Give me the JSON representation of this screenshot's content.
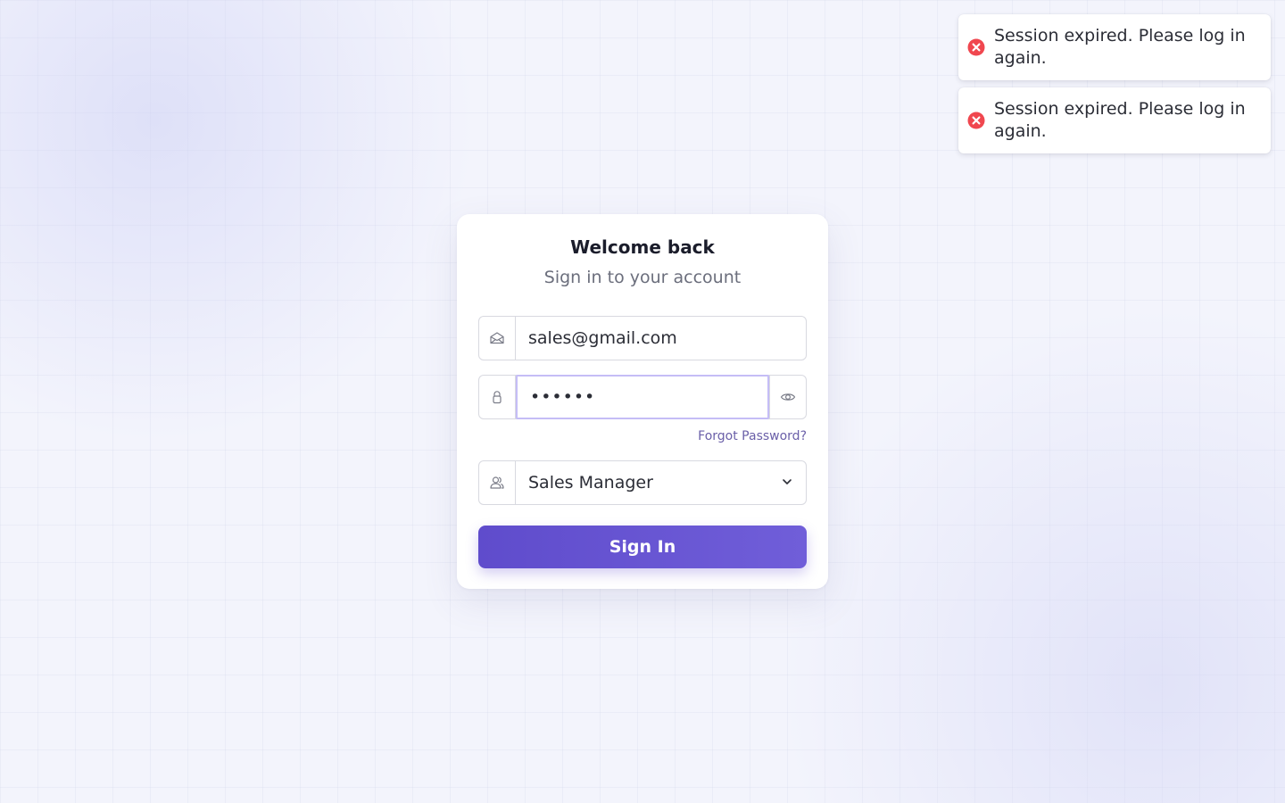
{
  "toasts": [
    {
      "message": "Session expired. Please log in again."
    },
    {
      "message": "Session expired. Please log in again."
    }
  ],
  "login": {
    "title": "Welcome back",
    "subtitle": "Sign in to your account",
    "email_value": "sales@gmail.com",
    "password_value": "••••••",
    "forgot_label": "Forgot Password?",
    "role_value": "Sales Manager",
    "signin_label": "Sign In"
  },
  "icons": {
    "toast": "error-circle-icon",
    "email": "envelope-icon",
    "password": "lock-icon",
    "show_password": "eye-icon",
    "role": "users-icon",
    "dropdown": "chevron-down-icon"
  },
  "colors": {
    "accent": "#6453d0",
    "error": "#f0474f",
    "link": "#6a5fa8",
    "focus_border": "#c5bdf6"
  }
}
